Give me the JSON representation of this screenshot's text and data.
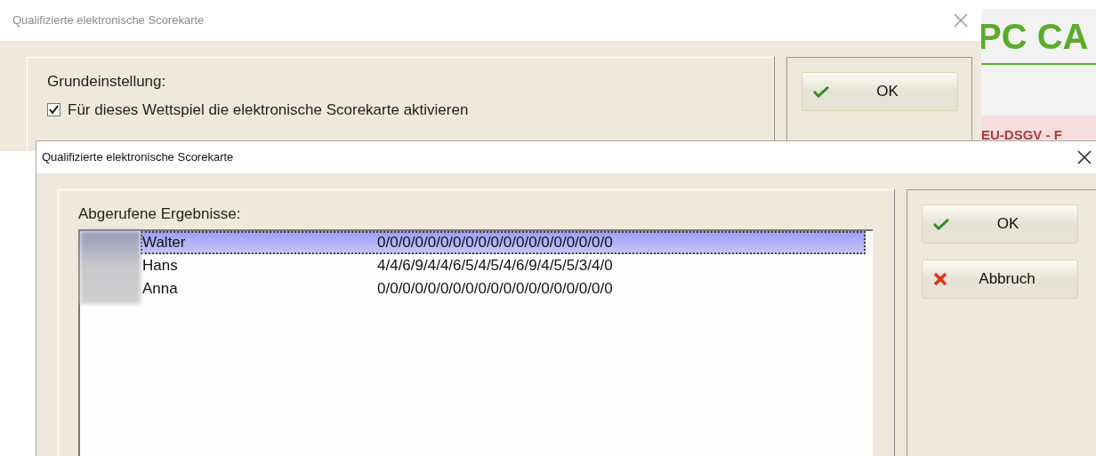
{
  "background_app": {
    "logo": "PC CA",
    "banner": "EU-DSGV - F"
  },
  "back_dialog": {
    "title": "Qualifizierte elektronische Scorekarte",
    "section_label": "Grundeinstellung:",
    "checkbox": {
      "label": "Für dieses Wettspiel die elektronische Scorekarte aktivieren",
      "checked": true
    },
    "buttons": [
      {
        "label": "OK",
        "kind": "ok"
      }
    ]
  },
  "front_dialog": {
    "title": "Qualifizierte elektronische Scorekarte",
    "list_label": "Abgerufene Ergebnisse:",
    "rows": [
      {
        "name": "Walter",
        "scores": "0/0/0/0/0/0/0/0/0/0/0/0/0/0/0/0/0/0/0",
        "selected": true
      },
      {
        "name": "Hans",
        "scores": "4/4/6/9/4/4/6/5/4/5/4/6/9/4/5/5/3/4/0",
        "selected": false
      },
      {
        "name": "Anna",
        "scores": "0/0/0/0/0/0/0/0/0/0/0/0/0/0/0/0/0/0/0",
        "selected": false
      }
    ],
    "buttons": [
      {
        "label": "OK",
        "kind": "ok"
      },
      {
        "label": "Abbruch",
        "kind": "cancel"
      }
    ]
  }
}
